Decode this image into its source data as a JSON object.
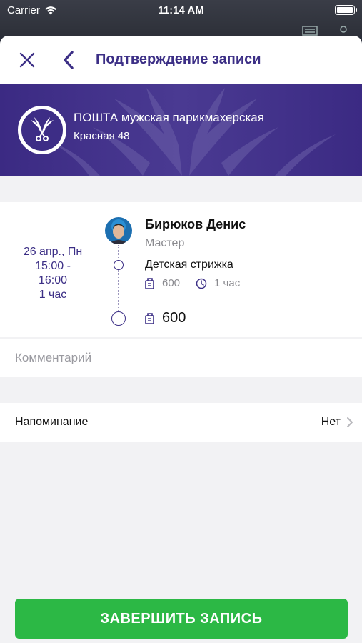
{
  "status_bar": {
    "carrier": "Carrier",
    "time": "11:14 AM"
  },
  "nav": {
    "title": "Подтверждение записи",
    "close_icon": "close-icon",
    "back_icon": "chevron-left-icon"
  },
  "salon": {
    "name": "ПОШТА мужская парикмахерская",
    "address": "Красная 48",
    "logo_icon": "winged-scissors-logo"
  },
  "appointment": {
    "date": "26 апр., Пн",
    "time_range_start": "15:00 -",
    "time_range_end": "16:00",
    "duration": "1 час",
    "master_name": "Бирюков Денис",
    "master_role": "Мастер",
    "service_name": "Детская стрижка",
    "service_price": "600",
    "service_duration": "1 час",
    "total": "600"
  },
  "comment": {
    "placeholder": "Комментарий"
  },
  "reminder": {
    "label": "Напоминание",
    "value": "Нет"
  },
  "submit": {
    "label": "ЗАВЕРШИТЬ ЗАПИСЬ"
  },
  "colors": {
    "brand": "#3c2f86",
    "accent_green": "#2cb845",
    "background": "#f2f2f4"
  }
}
